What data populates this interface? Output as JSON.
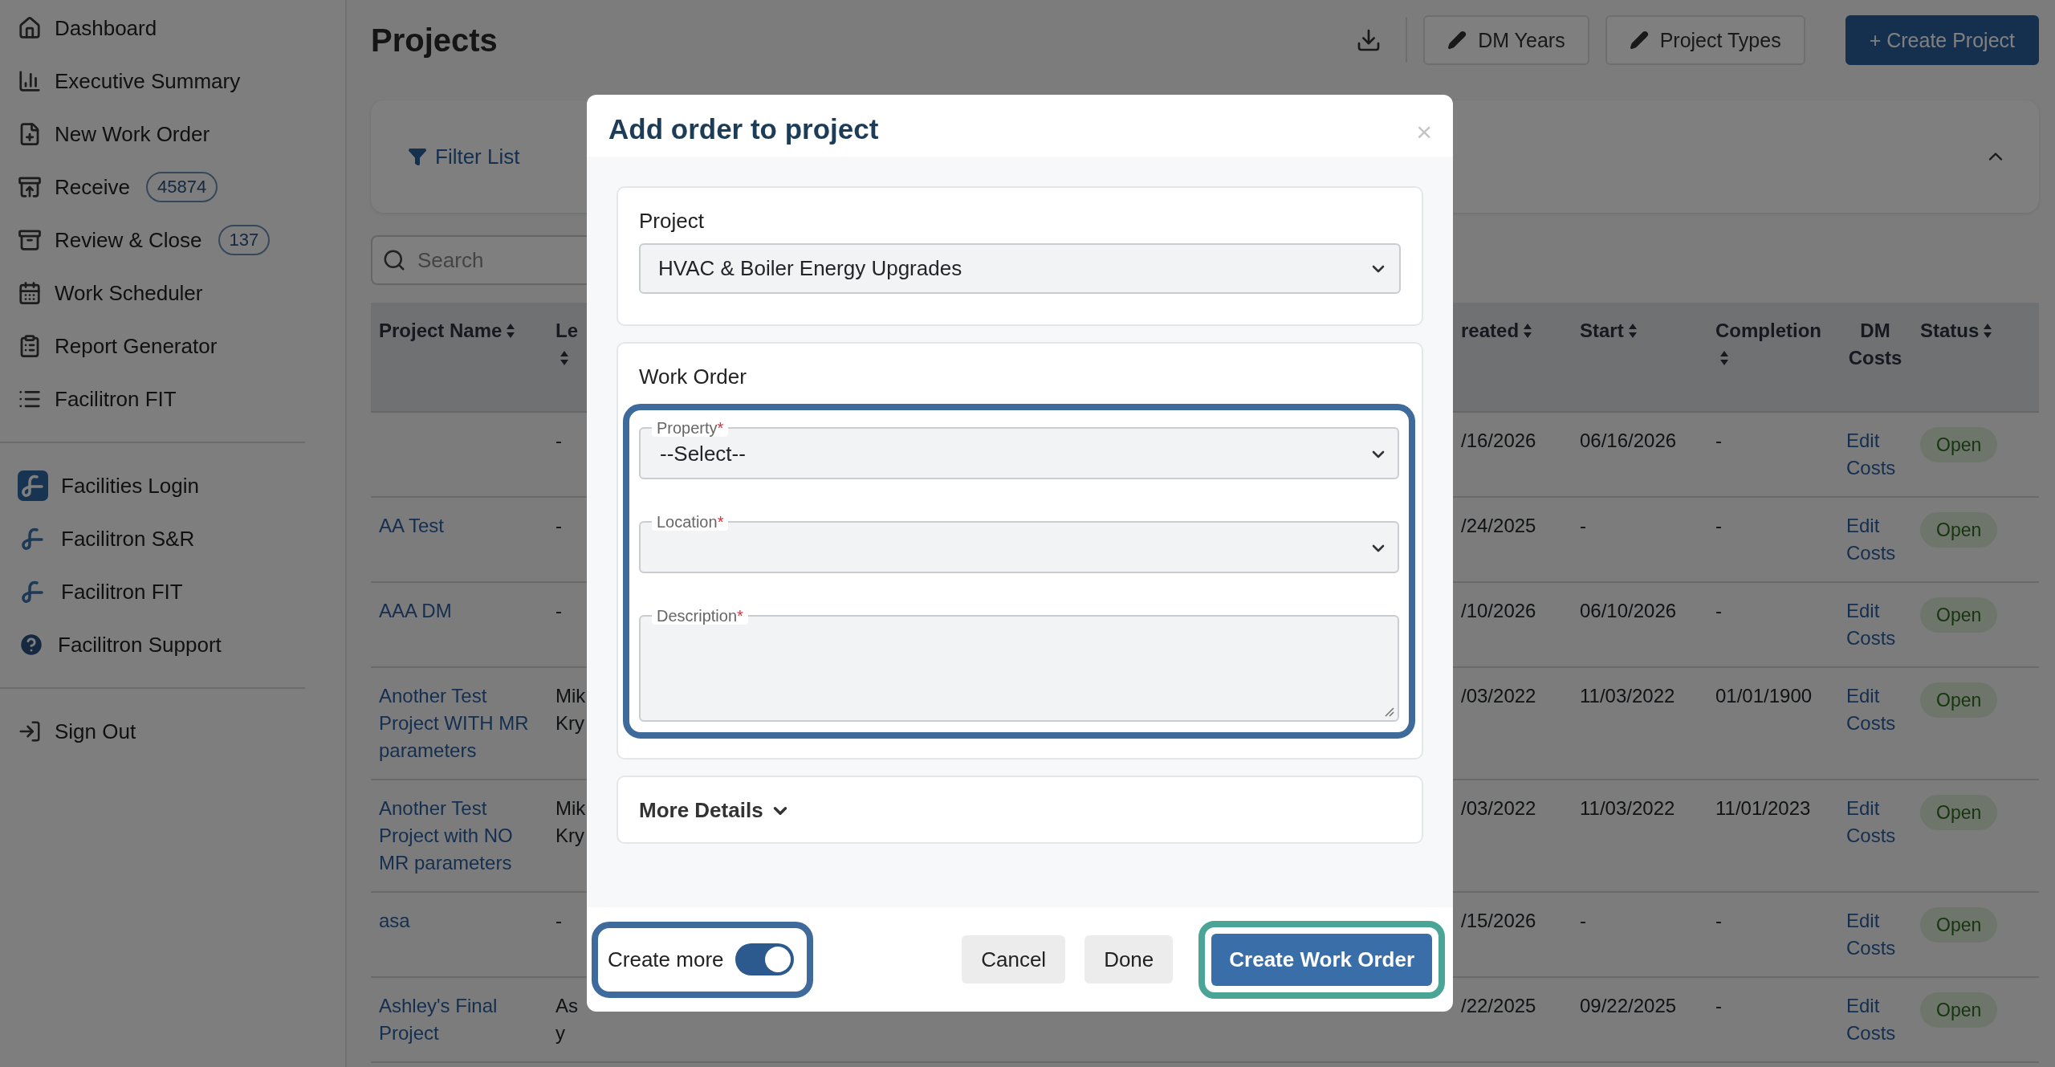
{
  "sidebar": {
    "nav": [
      {
        "label": "Dashboard"
      },
      {
        "label": "Executive Summary"
      },
      {
        "label": "New Work Order"
      },
      {
        "label": "Receive",
        "badge": "45874"
      },
      {
        "label": "Review & Close",
        "badge": "137"
      },
      {
        "label": "Work Scheduler"
      },
      {
        "label": "Report Generator"
      },
      {
        "label": "Facilitron FIT"
      }
    ],
    "links": [
      {
        "label": "Facilities Login"
      },
      {
        "label": "Facilitron S&R"
      },
      {
        "label": "Facilitron FIT"
      },
      {
        "label": "Facilitron Support"
      }
    ],
    "footer": [
      {
        "label": "Sign Out"
      }
    ]
  },
  "header": {
    "title": "Projects",
    "buttons": [
      {
        "kind": "outline",
        "label": "DM Years"
      },
      {
        "kind": "outline",
        "label": "Project Types"
      },
      {
        "kind": "primary",
        "label": "+ Create Project"
      }
    ]
  },
  "filter": {
    "label": "Filter List",
    "expanded": true
  },
  "search": {
    "placeholder": "Search"
  },
  "table": {
    "columns": [
      {
        "label": "Project Name",
        "sortable": true
      },
      {
        "label": "Le",
        "sortable": true
      },
      {
        "label": "reated",
        "sortable": true
      },
      {
        "label": "Start",
        "sortable": true
      },
      {
        "label": "Completion",
        "sortable": true
      },
      {
        "label": "DM Costs",
        "sortable": false
      },
      {
        "label": "Status",
        "sortable": true
      }
    ],
    "rows": [
      {
        "name": "",
        "lead": "-",
        "created": "/16/2026",
        "start": "06/16/2026",
        "completion": "-",
        "dm_costs": "Edit Costs",
        "status": "Open"
      },
      {
        "name": "AA Test",
        "lead": "-",
        "created": "/24/2025",
        "start": "-",
        "completion": "-",
        "dm_costs": "Edit Costs",
        "status": "Open"
      },
      {
        "name": "AAA DM",
        "lead": "-",
        "created": "/10/2026",
        "start": "06/10/2026",
        "completion": "-",
        "dm_costs": "Edit Costs",
        "status": "Open"
      },
      {
        "name": "Another Test Project WITH MR parameters",
        "lead": "Mik Kry",
        "created": "/03/2022",
        "start": "11/03/2022",
        "completion": "01/01/1900",
        "dm_costs": "Edit Costs",
        "status": "Open"
      },
      {
        "name": "Another Test Project with NO MR parameters",
        "lead": "Mik Kry",
        "created": "/03/2022",
        "start": "11/03/2022",
        "completion": "11/01/2023",
        "dm_costs": "Edit Costs",
        "status": "Open"
      },
      {
        "name": "asa",
        "lead": "-",
        "created": "/15/2026",
        "start": "-",
        "completion": "-",
        "dm_costs": "Edit Costs",
        "status": "Open"
      },
      {
        "name": "Ashley's Final Project",
        "lead": "As y",
        "created": "/22/2025",
        "start": "09/22/2025",
        "completion": "-",
        "dm_costs": "Edit Costs",
        "status": "Open"
      }
    ]
  },
  "modal": {
    "title": "Add order to project",
    "close": "×",
    "project": {
      "label": "Project",
      "value": "HVAC & Boiler Energy Upgrades"
    },
    "work_order": {
      "title": "Work Order",
      "fields": [
        {
          "kind": "select",
          "label": "Property",
          "mark": "*",
          "value": "--Select--"
        },
        {
          "kind": "select",
          "label": "Location",
          "mark": "*"
        },
        {
          "kind": "textarea",
          "label": "Description",
          "mark": "*"
        }
      ]
    },
    "more_details": {
      "label": "More Details",
      "expanded": false
    },
    "create_more": {
      "label": "Create more",
      "on": true
    },
    "buttons": [
      {
        "kind": "secondary",
        "label": "Cancel"
      },
      {
        "kind": "secondary",
        "label": "Done"
      },
      {
        "kind": "primary",
        "label": "Create Work Order"
      }
    ]
  }
}
